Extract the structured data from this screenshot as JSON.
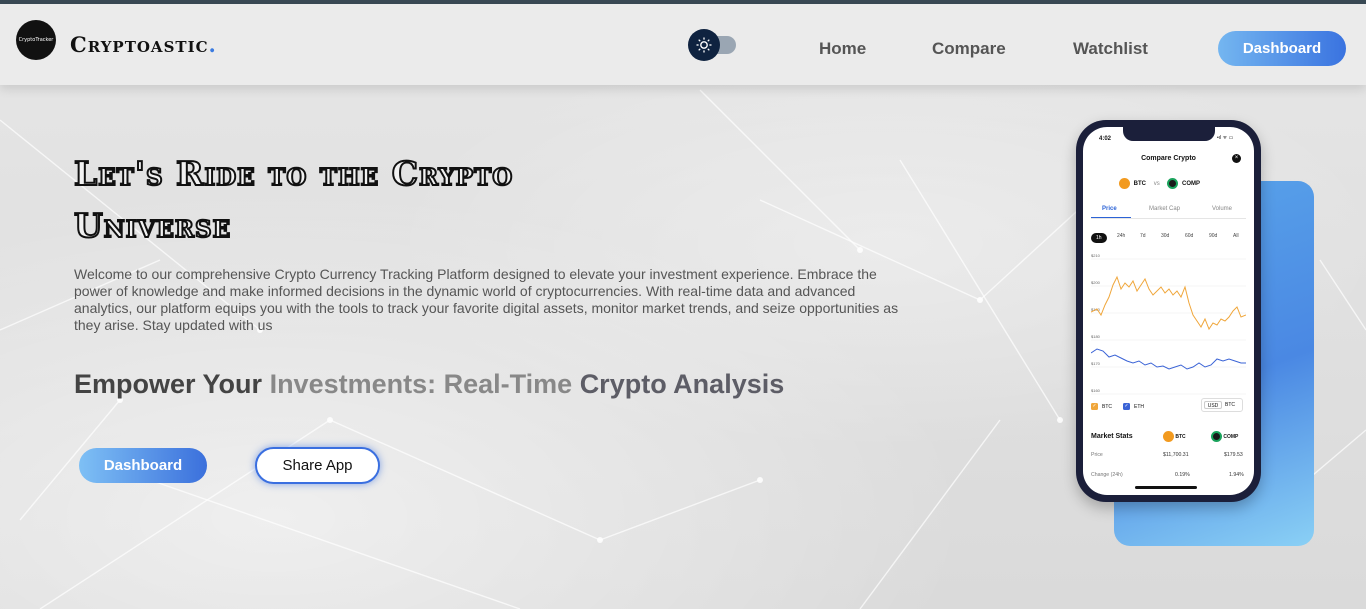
{
  "header": {
    "logo_text": "CryptoTracker",
    "brand": "Cryptoastic",
    "brand_dot": ".",
    "nav": [
      "Home",
      "Compare",
      "Watchlist"
    ],
    "dashboard_label": "Dashboard"
  },
  "hero": {
    "title_line1": "Let's Ride to the Crypto",
    "title_line2": "Universe",
    "description": "Welcome to our comprehensive Crypto Currency Tracking Platform designed to elevate your investment experience. Embrace the power of knowledge and make informed decisions in the dynamic world of cryptocurrencies. With real-time data and advanced analytics, our platform equips you with the tools to track your favorite digital assets, monitor market trends, and seize opportunities as they arise. Stay updated with us",
    "tagline_start": "Empower Your",
    "tagline_mid": "Investments: Real-Time",
    "tagline_end": "Crypto Analysis",
    "dashboard_button": "Dashboard",
    "share_button": "Share App"
  },
  "phone": {
    "time": "4:02",
    "status_icons": "•ıl ᯤ ▭",
    "title": "Compare Crypto",
    "coin_a": "BTC",
    "vs": "vs",
    "coin_b": "COMP",
    "tabs": [
      "Price",
      "Market Cap",
      "Volume"
    ],
    "ranges": [
      "1h",
      "24h",
      "7d",
      "30d",
      "60d",
      "90d",
      "All"
    ],
    "y_labels": [
      "$210",
      "$200",
      "$190",
      "$180",
      "$170",
      "$160"
    ],
    "legend": [
      "BTC",
      "ETH"
    ],
    "currency_toggle": [
      "USD",
      "BTC"
    ],
    "market_stats": "Market Stats",
    "stats": [
      {
        "label": "Price",
        "a": "$11,700.31",
        "b": "$179.53"
      },
      {
        "label": "Change (24h)",
        "a": "0.19%",
        "b": "1.94%"
      }
    ],
    "colors": {
      "btc": "#f29a1f",
      "comp": "#1aa35c",
      "line_a": "#f0a63a",
      "line_b": "#3a63d6"
    }
  }
}
